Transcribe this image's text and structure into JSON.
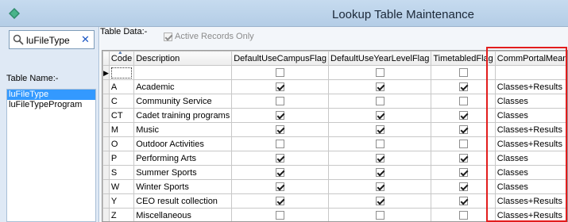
{
  "window": {
    "title": "Lookup Table Maintenance"
  },
  "sidebar": {
    "search_value": "luFileType",
    "clear_glyph": "✕",
    "table_name_label": "Table Name:-",
    "items": [
      {
        "label": "luFileType",
        "selected": true
      },
      {
        "label": "luFileTypeProgram",
        "selected": false
      }
    ]
  },
  "main": {
    "table_data_label": "Table Data:-",
    "active_records_label": "Active Records Only",
    "active_records_checked": true
  },
  "grid": {
    "columns": [
      "Code",
      "Description",
      "DefaultUseCampusFlag",
      "DefaultUseYearLevelFlag",
      "TimetabledFlag",
      "CommPortalMeaning"
    ],
    "new_row_marker": "▶",
    "rows": [
      {
        "code": "A",
        "description": "Academic",
        "campus": true,
        "year": true,
        "timetabled": true,
        "meaning": "Classes+Results"
      },
      {
        "code": "C",
        "description": "Community Service",
        "campus": false,
        "year": false,
        "timetabled": false,
        "meaning": "Classes"
      },
      {
        "code": "CT",
        "description": "Cadet training programs",
        "campus": true,
        "year": true,
        "timetabled": true,
        "meaning": "Classes"
      },
      {
        "code": "M",
        "description": "Music",
        "campus": true,
        "year": true,
        "timetabled": true,
        "meaning": "Classes+Results"
      },
      {
        "code": "O",
        "description": "Outdoor Activities",
        "campus": false,
        "year": false,
        "timetabled": false,
        "meaning": "Classes+Results"
      },
      {
        "code": "P",
        "description": "Performing Arts",
        "campus": true,
        "year": true,
        "timetabled": true,
        "meaning": "Classes"
      },
      {
        "code": "S",
        "description": "Summer Sports",
        "campus": true,
        "year": true,
        "timetabled": true,
        "meaning": "Classes"
      },
      {
        "code": "W",
        "description": "Winter Sports",
        "campus": true,
        "year": true,
        "timetabled": true,
        "meaning": "Classes"
      },
      {
        "code": "Y",
        "description": "CEO result collection",
        "campus": true,
        "year": true,
        "timetabled": true,
        "meaning": "Classes+Results"
      },
      {
        "code": "Z",
        "description": "Miscellaneous",
        "campus": false,
        "year": false,
        "timetabled": false,
        "meaning": "Classes+Results"
      }
    ]
  },
  "colors": {
    "highlight": "#e21d1d",
    "selection": "#3399ff",
    "titlebar": "#c6dbef"
  }
}
